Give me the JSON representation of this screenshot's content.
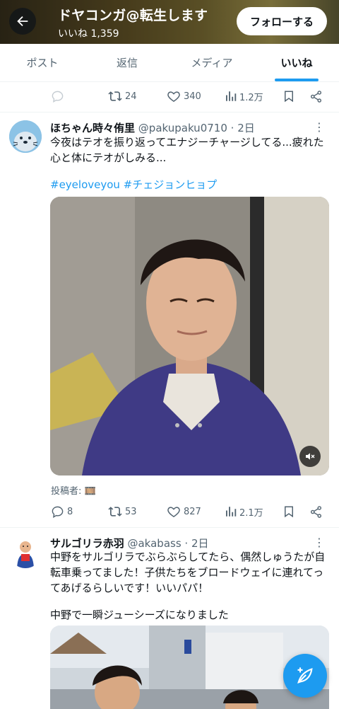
{
  "header": {
    "name": "ドヤコンガ@転生します",
    "likes_label": "いいね 1,359",
    "follow_label": "フォローする"
  },
  "tabs": [
    {
      "label": "ポスト"
    },
    {
      "label": "返信"
    },
    {
      "label": "メディア"
    },
    {
      "label": "いいね"
    }
  ],
  "prev_post": {
    "retweets": "24",
    "likes": "340",
    "views": "1.2万"
  },
  "tweets": [
    {
      "name": "ほちゃん時々侑里",
      "handle": "@pakupaku0710",
      "time": "· 2日",
      "text_line1": "今夜はテオを振り返ってエナジーチャージしてる...疲れた",
      "text_line2": "心と体にテオがしみる...",
      "hashtags": "#eyeloveyou #チェジョンヒョプ",
      "credit": "投稿者: 🎞️",
      "replies": "8",
      "retweets": "53",
      "likes": "827",
      "views": "2.1万"
    },
    {
      "name": "サルゴリラ赤羽",
      "handle": "@akabass",
      "time": "· 2日",
      "text_line1": "中野をサルゴリラでぶらぶらしてたら、偶然しゅうたが自",
      "text_line2": "転車乗ってました！子供たちをブロードウェイに連れてっ",
      "text_line3": "てあげるらしいです！いいパパ！",
      "text_line4": "中野で一瞬ジューシーズになりました"
    }
  ],
  "colors": {
    "accent": "#1d9bf0",
    "text": "#0f1419",
    "secondary": "#536471"
  }
}
